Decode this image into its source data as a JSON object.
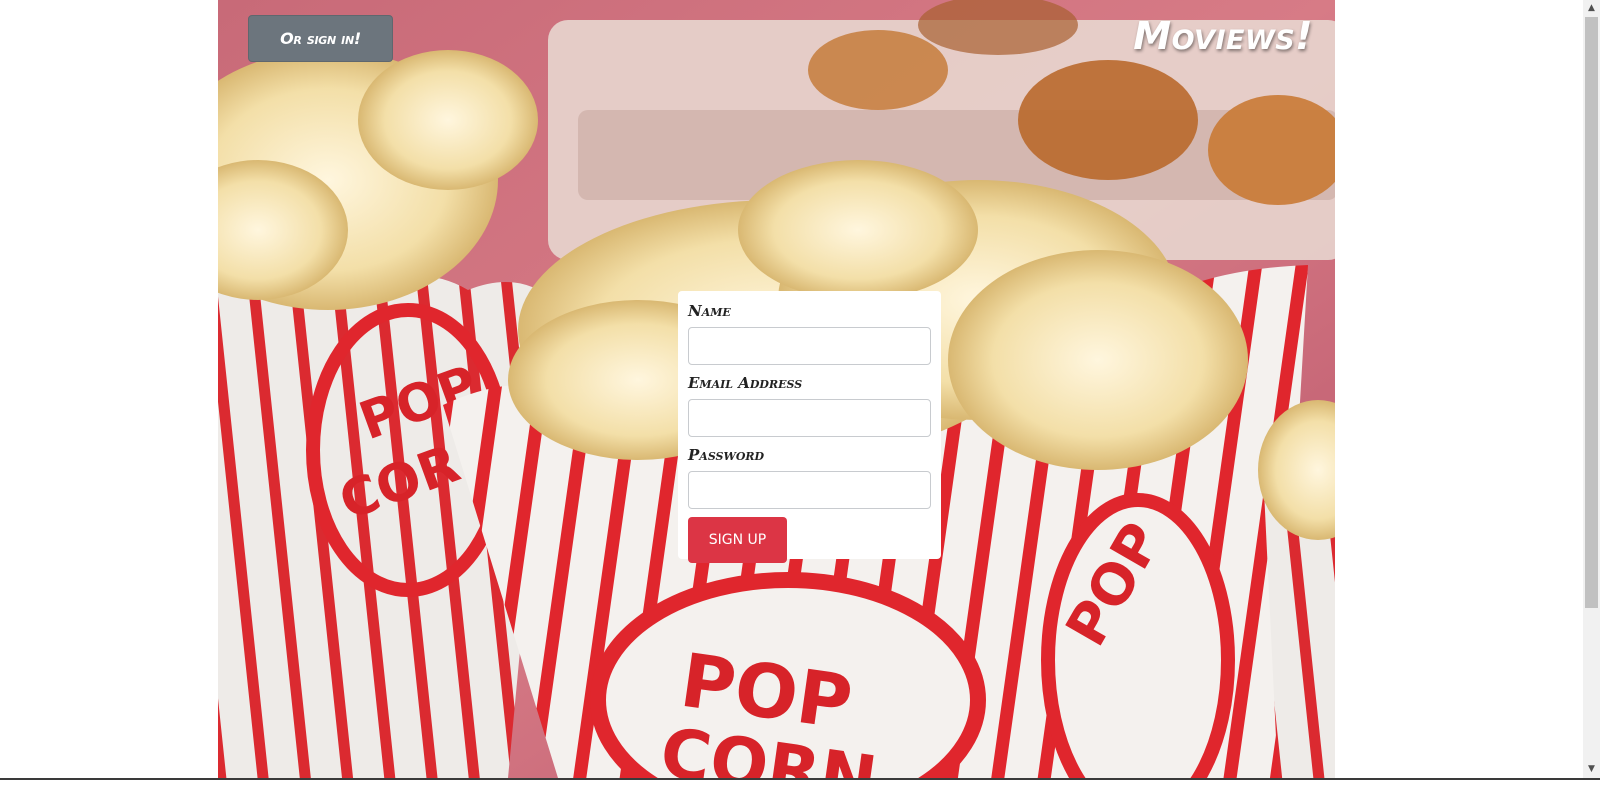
{
  "header": {
    "signin_label": "Or sign in!",
    "brand": "Moviews!"
  },
  "form": {
    "name_label": "Name",
    "email_label": "Email Address",
    "password_label": "Password",
    "name_value": "",
    "email_value": "",
    "password_value": "",
    "submit_label": "SIGN UP"
  },
  "colors": {
    "signin_button": "#6c757d",
    "signup_button": "#dc3545",
    "card": "#ffffff",
    "popcorn_stripe": "#e0262d"
  },
  "icons": {
    "scroll_up": "scroll-up-arrow-icon",
    "scroll_down": "scroll-down-arrow-icon"
  }
}
